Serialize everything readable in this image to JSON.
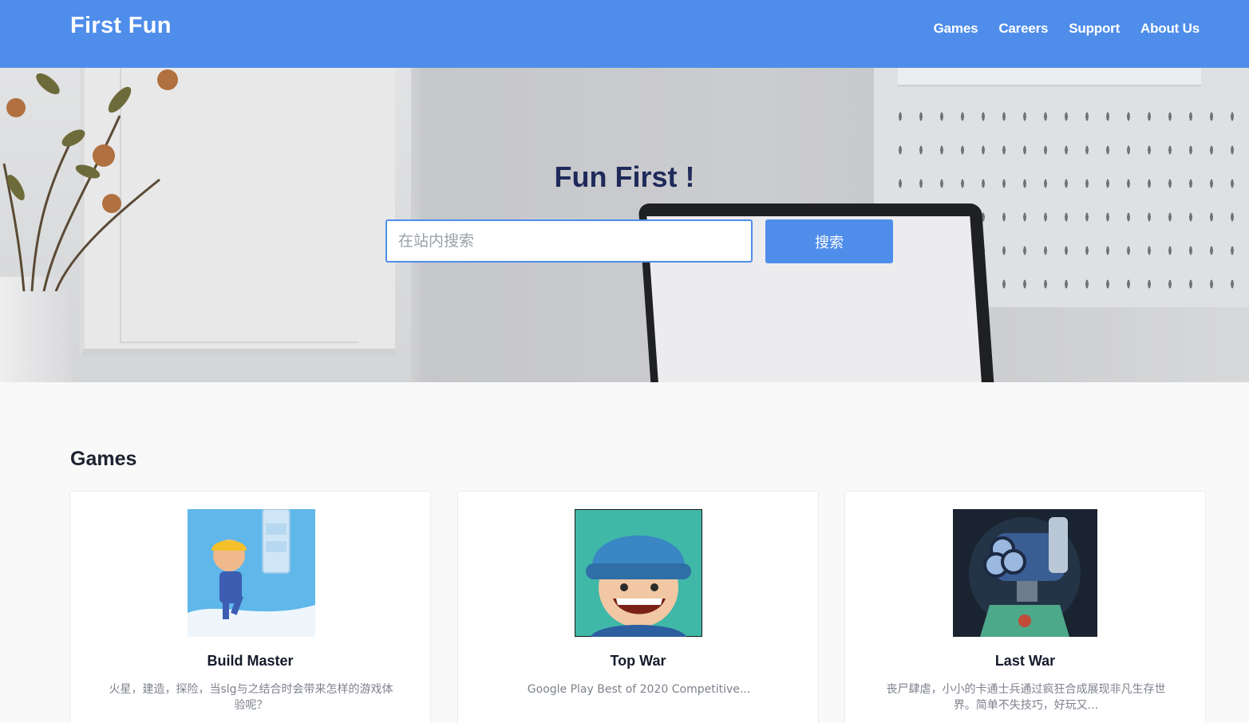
{
  "header": {
    "brand": "First Fun",
    "nav": [
      "Games",
      "Careers",
      "Support",
      "About Us"
    ]
  },
  "hero": {
    "title": "Fun First !",
    "search_placeholder": "在站内搜索",
    "search_button": "搜索"
  },
  "games_section": {
    "title": "Games",
    "items": [
      {
        "name": "Build Master",
        "description": "火星，建造，探险，当slg与之结合时会带来怎样的游戏体验呢？"
      },
      {
        "name": "Top War",
        "description": "Google Play Best of 2020 Competitive..."
      },
      {
        "name": "Last War",
        "description": "丧尸肆虐，小小的卡通士兵通过疯狂合成展现非凡生存世界。简单不失技巧，好玩又..."
      }
    ]
  },
  "colors": {
    "brand_blue": "#4f8dea",
    "title_navy": "#1f2a5a"
  }
}
